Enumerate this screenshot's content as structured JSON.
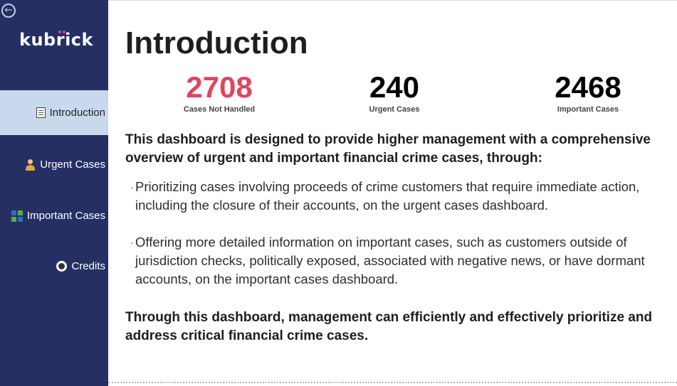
{
  "sidebar": {
    "logo": "kubrick",
    "items": [
      {
        "label": "Introduction",
        "icon": "document-icon",
        "active": true
      },
      {
        "label": "Urgent Cases",
        "icon": "person-icon",
        "active": false
      },
      {
        "label": "Important Cases",
        "icon": "grid-icon",
        "active": false
      },
      {
        "label": "Credits",
        "icon": "credits-icon",
        "active": false
      }
    ]
  },
  "main": {
    "title": "Introduction",
    "kpis": [
      {
        "value": "2708",
        "label": "Cases Not Handled",
        "color": "#e0445e"
      },
      {
        "value": "240",
        "label": "Urgent Cases",
        "color": "#000000"
      },
      {
        "value": "2468",
        "label": "Important Cases",
        "color": "#000000"
      }
    ],
    "intro": "This dashboard is designed to provide higher management with a comprehensive overview of urgent and important financial crime cases, through:",
    "bullets": [
      "Prioritizing cases involving proceeds of crime customers that require immediate action, including the closure of their accounts, on the urgent cases dashboard.",
      "Offering more detailed information on important cases, such as customers outside of jurisdiction checks, politically exposed, associated with negative news, or have dormant accounts, on the important cases dashboard."
    ],
    "closing": "Through this dashboard, management can efficiently and effectively prioritize and address critical financial crime cases."
  },
  "colors": {
    "sidebar_bg": "#252f63",
    "active_item_bg": "#c8d9ee",
    "accent_red": "#e0445e"
  }
}
